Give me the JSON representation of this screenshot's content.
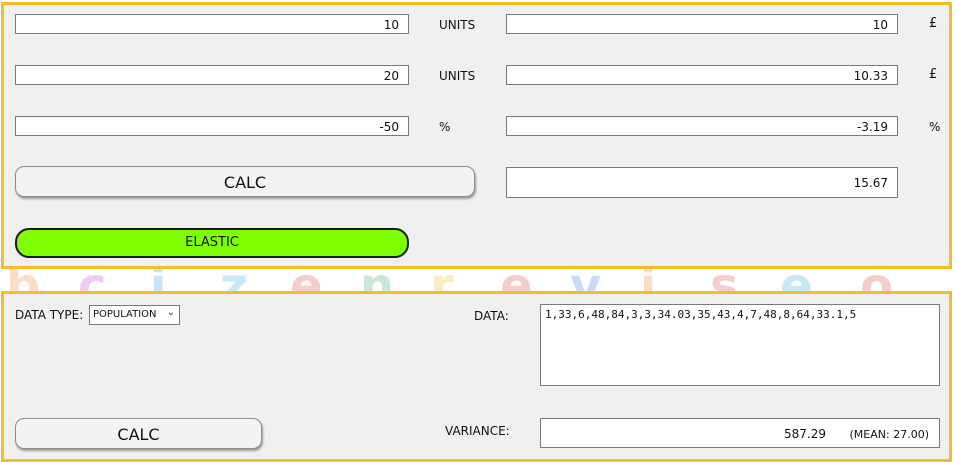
{
  "background_letters": [
    {
      "char": "b",
      "color": "#f08a3a"
    },
    {
      "char": "c",
      "color": "#c050c0"
    },
    {
      "char": "i",
      "color": "#40a0e0"
    },
    {
      "char": "z",
      "color": "#40b0e0"
    },
    {
      "char": "e",
      "color": "#e05050"
    },
    {
      "char": "n",
      "color": "#40b070"
    },
    {
      "char": "r",
      "color": "#f0c030"
    },
    {
      "char": "e",
      "color": "#e05050"
    },
    {
      "char": "v",
      "color": "#4080e0"
    },
    {
      "char": "i",
      "color": "#f08a3a"
    },
    {
      "char": "s",
      "color": "#e05050"
    },
    {
      "char": "e",
      "color": "#40b0e0"
    },
    {
      "char": "o",
      "color": "#e05050"
    }
  ],
  "elasticity": {
    "rows": [
      {
        "input": "10",
        "input_unit": "UNITS",
        "result": "10",
        "result_unit": "£"
      },
      {
        "input": "20",
        "input_unit": "UNITS",
        "result": "10.33",
        "result_unit": "£"
      },
      {
        "input": "-50",
        "input_unit": "%",
        "result": "-3.19",
        "result_unit": "%"
      }
    ],
    "calc_label": "CALC",
    "result_value": "15.67",
    "status_label": "ELASTIC",
    "status_color": "#80ff00"
  },
  "variance": {
    "data_type_label": "DATA TYPE:",
    "data_type_value": "POPULATION",
    "data_label": "DATA:",
    "data_value": "1,33,6,48,84,3,3,34.03,35,43,4,7,48,8,64,33.1,5",
    "calc_label": "CALC",
    "variance_label": "VARIANCE:",
    "variance_value": "587.29",
    "mean_text": "(MEAN: 27.00)"
  },
  "colors": {
    "panel_border": "#f5bd2a",
    "panel_bg": "#f0f0f0"
  }
}
